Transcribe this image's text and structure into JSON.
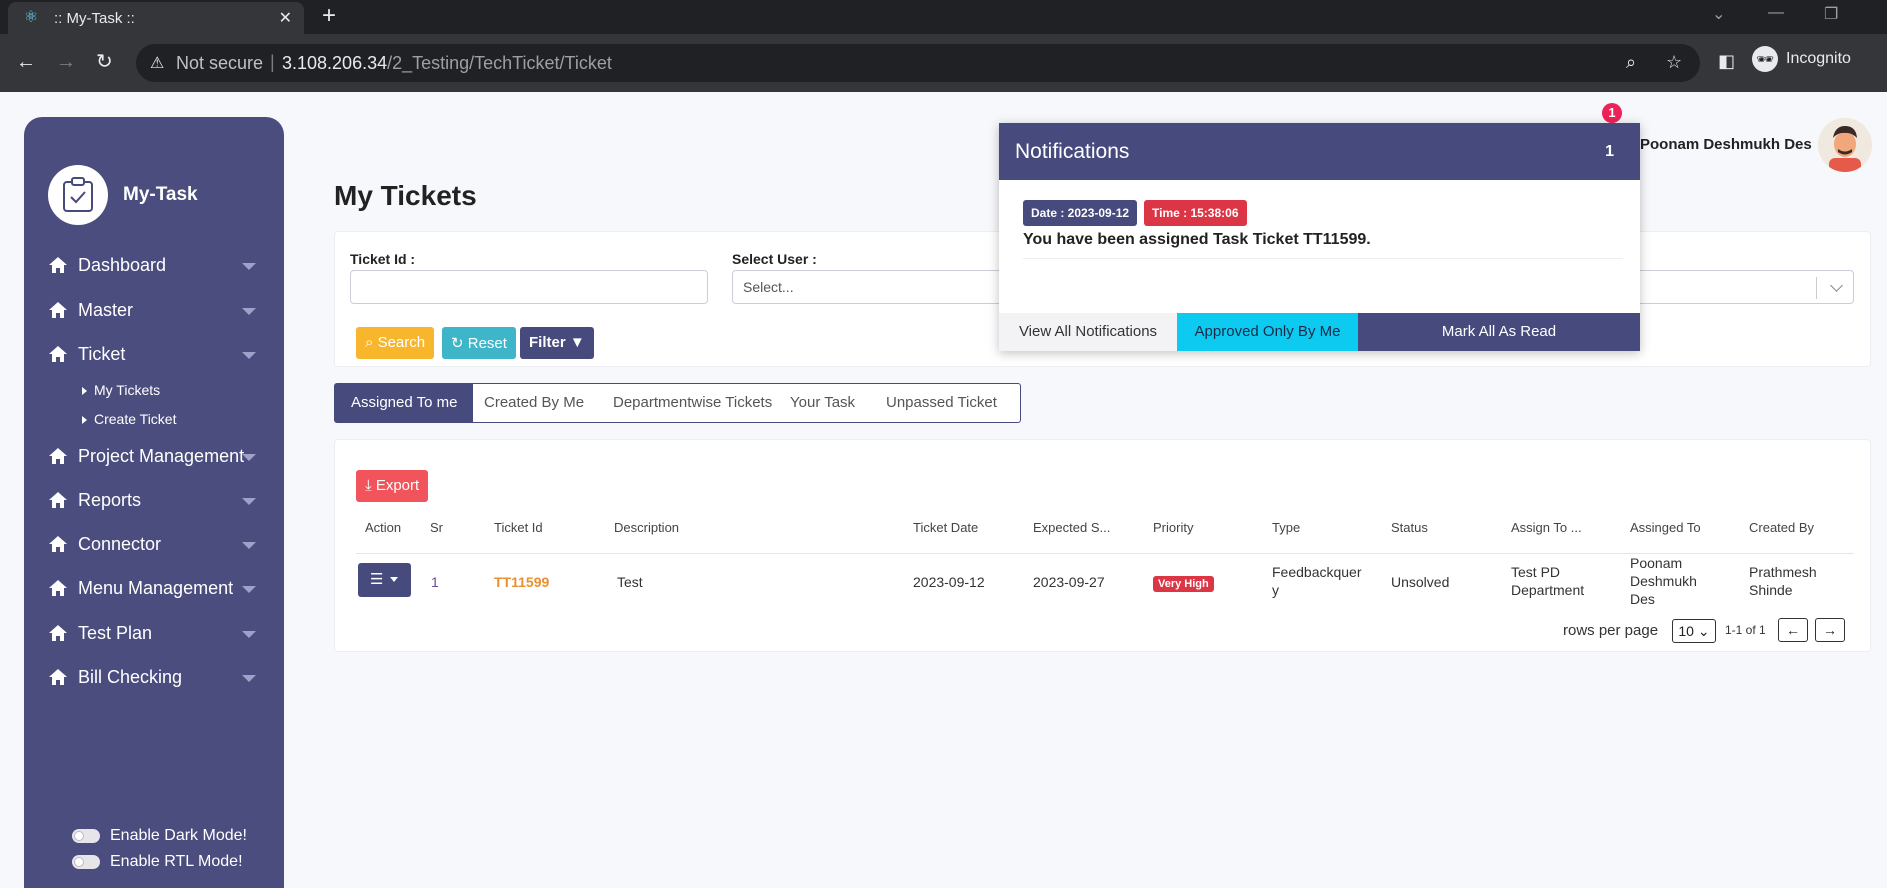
{
  "browser": {
    "tab_title": ":: My-Task ::",
    "tab_close": "✕",
    "new_tab": "+",
    "not_secure": "Not secure",
    "url_host": "3.108.206.34",
    "url_path": "/2_Testing/TechTicket/Ticket",
    "incognito": "Incognito"
  },
  "sidebar": {
    "brand": "My-Task",
    "items": [
      {
        "label": "Dashboard"
      },
      {
        "label": "Master"
      },
      {
        "label": "Ticket"
      },
      {
        "label": "Project Management"
      },
      {
        "label": "Reports"
      },
      {
        "label": "Connector"
      },
      {
        "label": "Menu Management"
      },
      {
        "label": "Test Plan"
      },
      {
        "label": "Bill Checking"
      }
    ],
    "sub_items": [
      {
        "label": "My Tickets"
      },
      {
        "label": "Create Ticket"
      }
    ],
    "dark_mode_label": "Enable Dark Mode!",
    "rtl_mode_label": "Enable RTL Mode!"
  },
  "page": {
    "title": "My Tickets"
  },
  "filters": {
    "ticket_id_label": "Ticket Id :",
    "ticket_id_value": "",
    "select_user_label": "Select User :",
    "select_user_placeholder": "Select...",
    "search_label": "Search",
    "reset_label": "Reset",
    "filter_label": "Filter"
  },
  "tabs": [
    {
      "label": "Assigned To me",
      "active": true
    },
    {
      "label": "Created By Me"
    },
    {
      "label": "Departmentwise Tickets"
    },
    {
      "label": "Your Task"
    },
    {
      "label": "Unpassed Ticket"
    }
  ],
  "table": {
    "export_label": "Export",
    "columns": [
      "Action",
      "Sr",
      "Ticket Id",
      "Description",
      "Ticket Date",
      "Expected S...",
      "Priority",
      "Type",
      "Status",
      "Assign To ...",
      "Assinged To",
      "Created By"
    ],
    "rows": [
      {
        "sr": "1",
        "ticket_id": "TT11599",
        "description": "Test",
        "ticket_date": "2023-09-12",
        "expected": "2023-09-27",
        "priority": "Very High",
        "type": "Feedbackquer y",
        "status": "Unsolved",
        "assign_to_dept": "Test PD Department",
        "assigned_to": "Poonam Deshmukh Des",
        "created_by": "Prathmesh Shinde"
      }
    ],
    "rows_per_page_label": "rows per page",
    "rows_per_page_value": "10",
    "range": "1-1 of 1"
  },
  "notifications": {
    "title": "Notifications",
    "count": "1",
    "badge": "1",
    "items": [
      {
        "date": "Date : 2023-09-12",
        "time": "Time : 15:38:06",
        "message": "You have been assigned Task Ticket TT11599."
      }
    ],
    "view_all": "View All Notifications",
    "approved_only": "Approved Only By Me",
    "mark_all": "Mark All As Read"
  },
  "user": {
    "name": "Poonam Deshmukh Des"
  },
  "colors": {
    "sidebar": "#4a4d7e",
    "primary": "#464a7d",
    "warning": "#f8b62d",
    "info": "#3fb5c9",
    "danger": "#dc3545",
    "cyan": "#0dcaf0"
  }
}
